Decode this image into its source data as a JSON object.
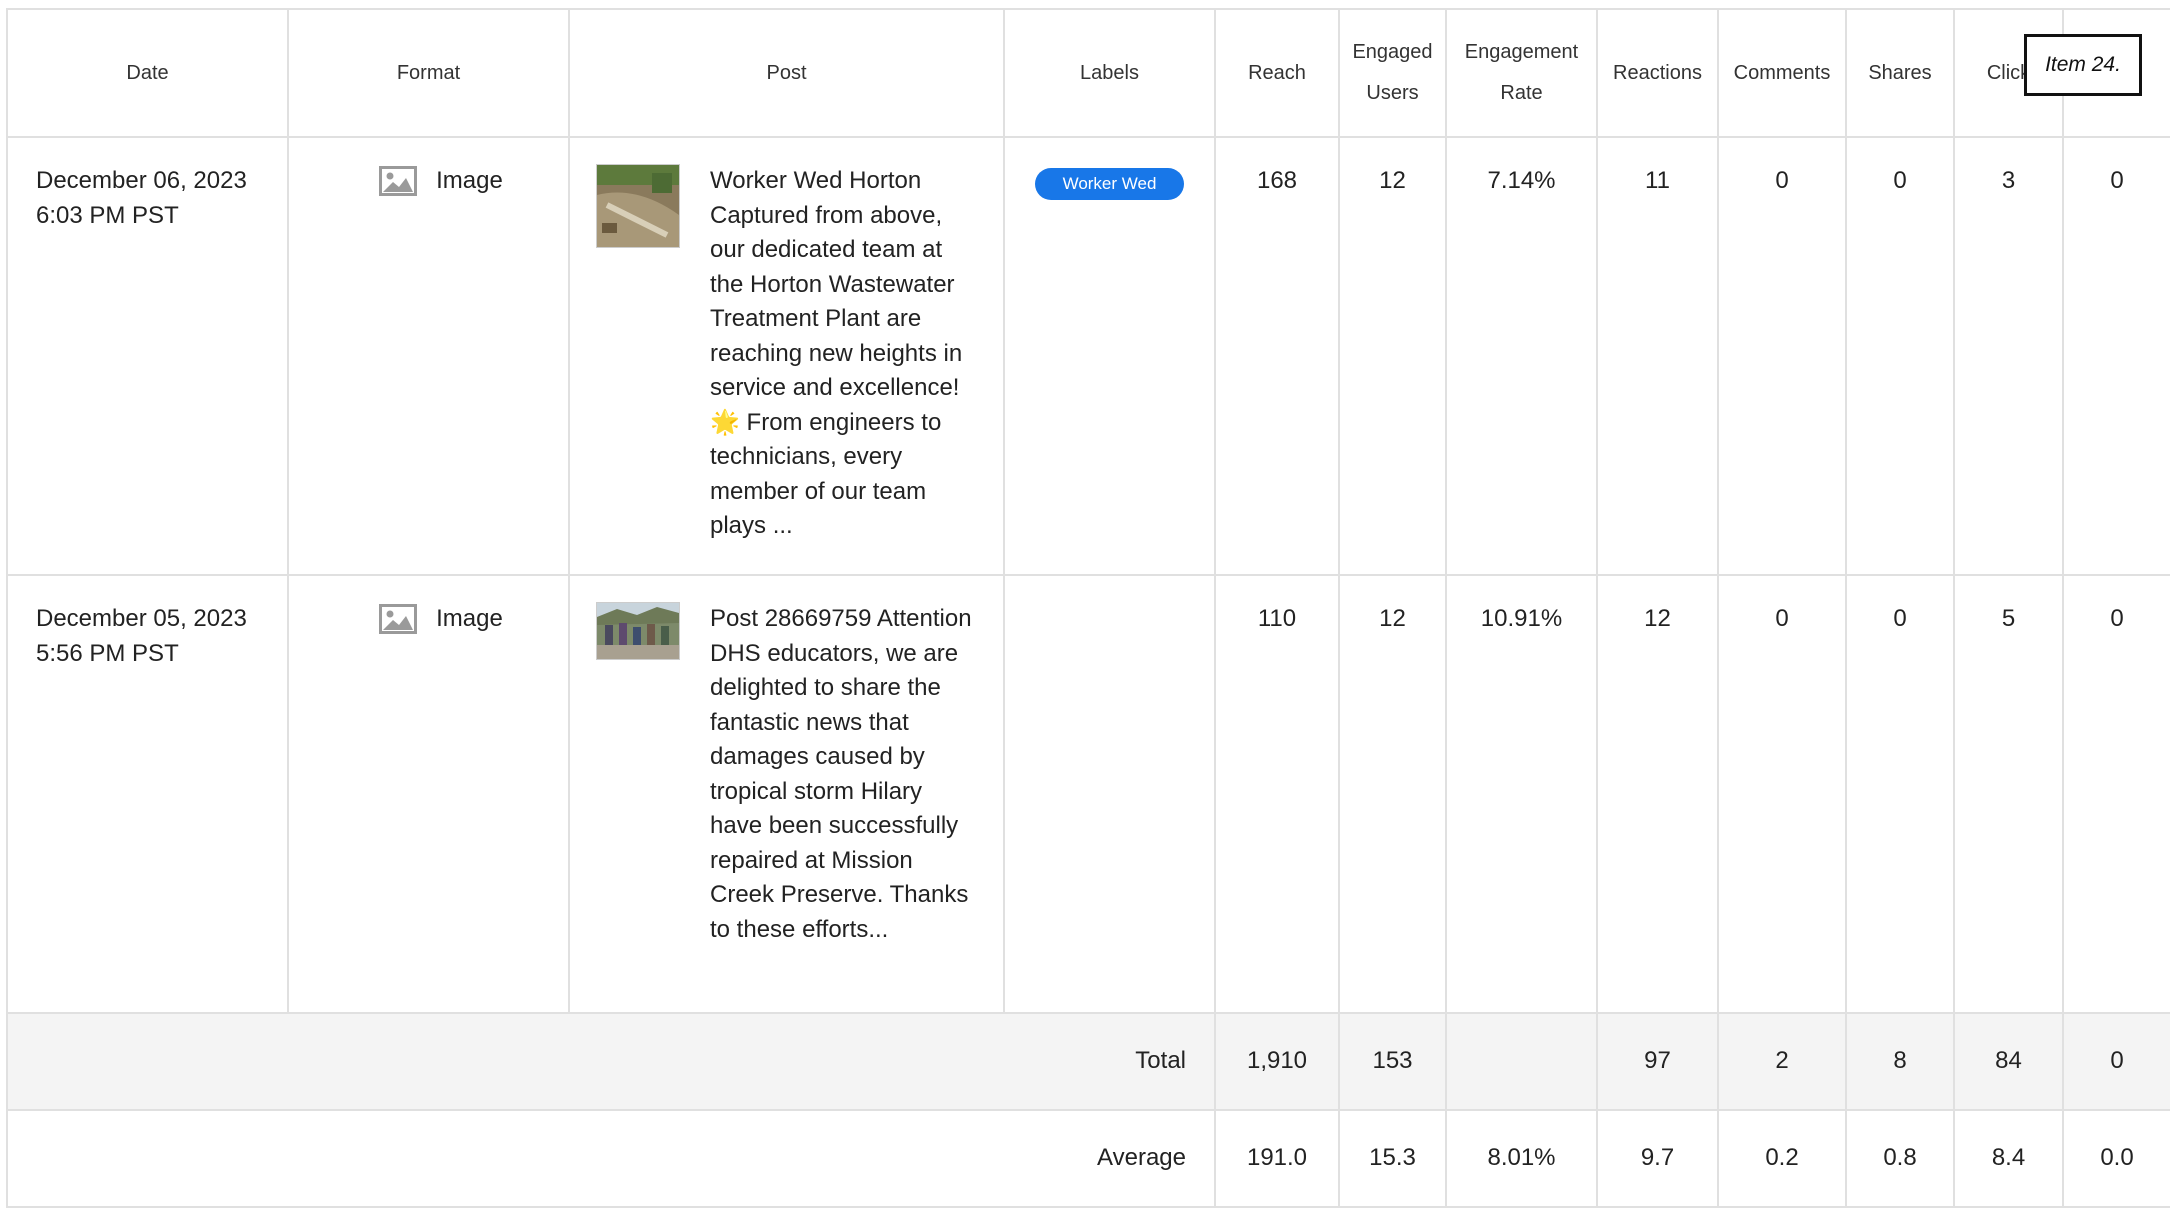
{
  "columns": {
    "date": "Date",
    "format": "Format",
    "post": "Post",
    "labels": "Labels",
    "reach": "Reach",
    "engaged_users_1": "Engaged",
    "engaged_users_2": "Users",
    "engagement_rate_1": "Engagement",
    "engagement_rate_2": "Rate",
    "reactions": "Reactions",
    "comments": "Comments",
    "shares": "Shares",
    "clicks": "Click",
    "extra": ""
  },
  "rows": [
    {
      "date_line1": "December 06, 2023",
      "date_line2": "6:03 PM PST",
      "format": "Image",
      "format_icon": "image-icon",
      "post_text": "Worker Wed Horton Captured from above, our dedicated team at the Horton Wastewater Treatment Plant are reaching new heights in service and excellence! 🌟 From engineers to technicians, every member of our team plays ...",
      "label": "Worker Wed",
      "reach": "168",
      "engaged_users": "12",
      "engagement_rate": "7.14%",
      "reactions": "11",
      "comments": "0",
      "shares": "0",
      "clicks": "3",
      "extra": "0"
    },
    {
      "date_line1": "December 05, 2023",
      "date_line2": "5:56 PM PST",
      "format": "Image",
      "format_icon": "image-icon",
      "post_text": "Post 28669759 Attention DHS educators, we are delighted to share the fantastic news that damages caused by tropical storm Hilary have been successfully repaired at Mission Creek Preserve. Thanks to these efforts...",
      "label": "",
      "reach": "110",
      "engaged_users": "12",
      "engagement_rate": "10.91%",
      "reactions": "12",
      "comments": "0",
      "shares": "0",
      "clicks": "5",
      "extra": "0"
    }
  ],
  "total": {
    "label": "Total",
    "reach": "1,910",
    "engaged_users": "153",
    "engagement_rate": "",
    "reactions": "97",
    "comments": "2",
    "shares": "8",
    "clicks": "84",
    "extra": "0"
  },
  "average": {
    "label": "Average",
    "reach": "191.0",
    "engaged_users": "15.3",
    "engagement_rate": "8.01%",
    "reactions": "9.7",
    "comments": "0.2",
    "shares": "0.8",
    "clicks": "8.4",
    "extra": "0.0"
  },
  "item_tag": "Item 24.",
  "colors": {
    "label_pill": "#1877e8",
    "total_row_bg": "#f4f4f4",
    "grid_line": "#e0e0e0"
  }
}
